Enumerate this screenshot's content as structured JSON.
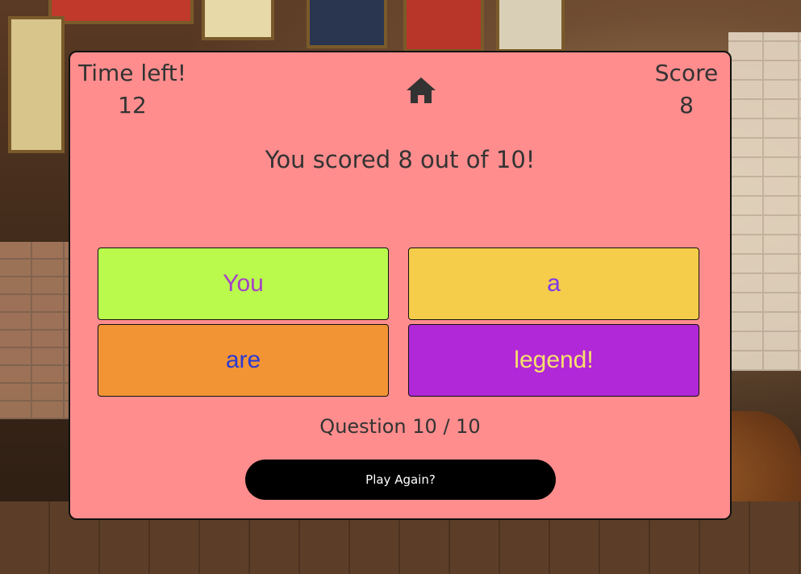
{
  "header": {
    "time_label": "Time left!",
    "time_value": "12",
    "score_label": "Score",
    "score_value": "8",
    "home_icon": "home-icon"
  },
  "result": {
    "message": "You scored 8 out of 10!"
  },
  "answers": [
    {
      "label": "You",
      "bg": "#b9fa4d",
      "color": "#a740c7"
    },
    {
      "label": "a",
      "bg": "#f5cd4a",
      "color": "#7a3be8"
    },
    {
      "label": "are",
      "bg": "#f39434",
      "color": "#2a3ad2"
    },
    {
      "label": "legend!",
      "bg": "#b128d8",
      "color": "#f7e26b"
    }
  ],
  "progress": {
    "question_text": "Question 10 / 10"
  },
  "actions": {
    "play_again_label": "Play Again?"
  },
  "colors": {
    "card_bg": "#ff8d8d",
    "button_bg": "#000000"
  }
}
